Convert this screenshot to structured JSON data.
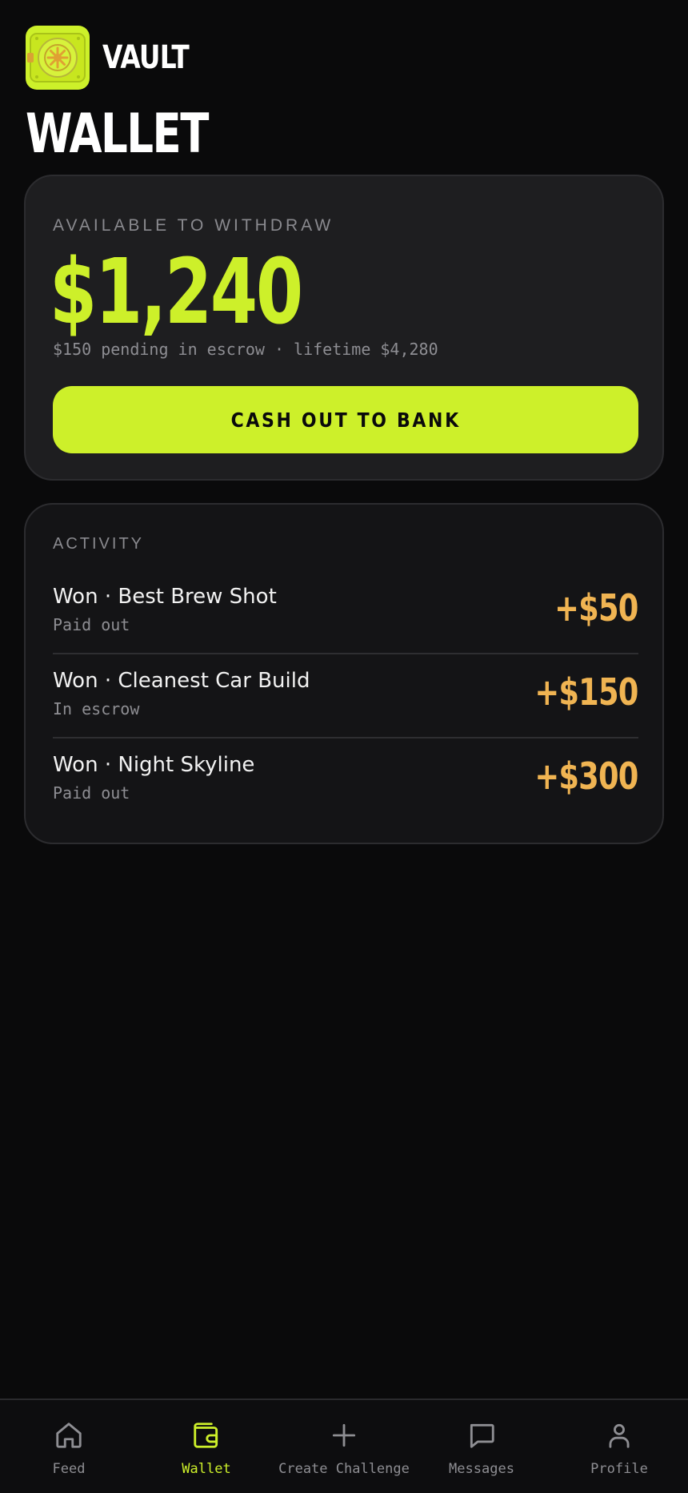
{
  "app": {
    "brand": "VAULT"
  },
  "header": {
    "title": "WALLET"
  },
  "balance": {
    "label": "AVAILABLE TO WITHDRAW",
    "amount": "$1,240",
    "subtext": "$150 pending in escrow · lifetime $4,280",
    "cashout_label": "CASH OUT TO BANK"
  },
  "activity": {
    "label": "ACTIVITY",
    "items": [
      {
        "title": "Won · Best Brew Shot",
        "status": "Paid out",
        "amount": "+$50"
      },
      {
        "title": "Won · Cleanest Car Build",
        "status": "In escrow",
        "amount": "+$150"
      },
      {
        "title": "Won · Night Skyline",
        "status": "Paid out",
        "amount": "+$300"
      }
    ]
  },
  "nav": {
    "items": [
      {
        "label": "Feed",
        "icon": "home-icon",
        "active": false
      },
      {
        "label": "Wallet",
        "icon": "wallet-icon",
        "active": true
      },
      {
        "label": "Create Challenge",
        "icon": "plus-icon",
        "active": false
      },
      {
        "label": "Messages",
        "icon": "chat-bubble-icon",
        "active": false
      },
      {
        "label": "Profile",
        "icon": "user-icon",
        "active": false
      }
    ]
  },
  "colors": {
    "accent": "#cdf02a",
    "amount": "#f0b452",
    "background": "#0a0a0b",
    "card": "#1e1e20",
    "muted": "#8e8e93"
  }
}
